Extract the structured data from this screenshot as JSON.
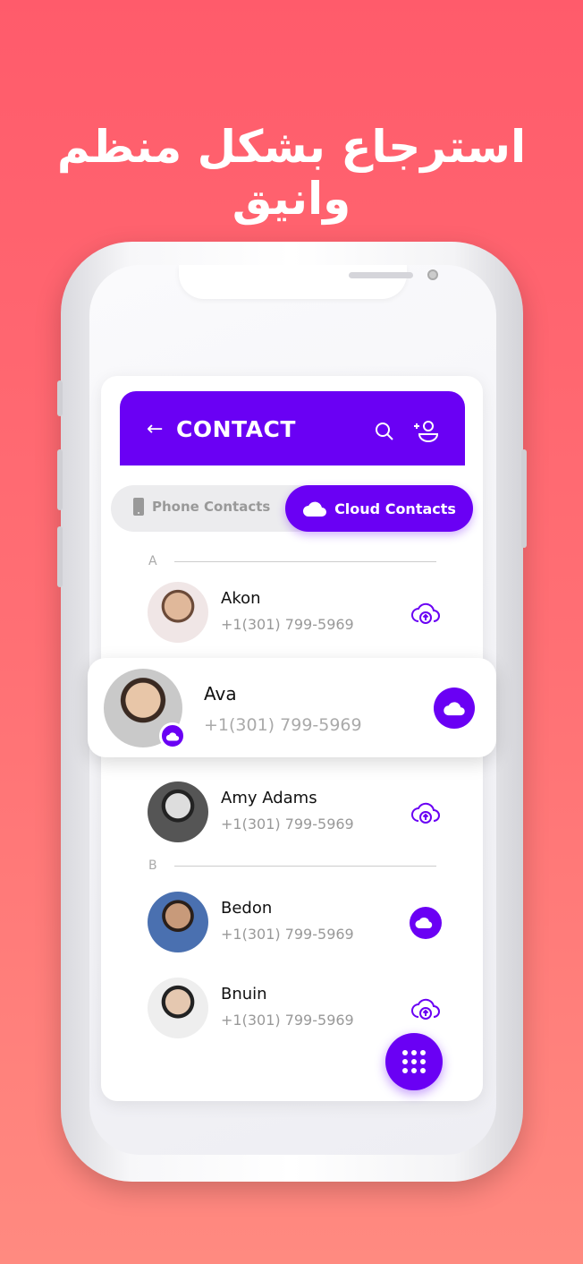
{
  "headline": "استرجاع بشكل منظم وانيق",
  "header": {
    "title": "CONTACT",
    "back_icon": "arrow-left-icon",
    "search_icon": "search-icon",
    "add_icon": "add-user-icon"
  },
  "tabs": {
    "phone": "Phone Contacts",
    "cloud": "Cloud Contacts",
    "active": "cloud"
  },
  "sections": [
    "A",
    "B"
  ],
  "contacts": [
    {
      "name": "Akon",
      "phone": "+1(301) 799-5969",
      "status": "upload"
    },
    {
      "name": "Ava",
      "phone": "+1(301) 799-5969",
      "status": "synced"
    },
    {
      "name": "Amy Adams",
      "phone": "+1(301) 799-5969",
      "status": "upload"
    },
    {
      "name": "Bedon",
      "phone": "+1(301) 799-5969",
      "status": "synced"
    },
    {
      "name": "Bnuin",
      "phone": "+1(301) 799-5969",
      "status": "upload"
    }
  ],
  "colors": {
    "accent": "#6a00f4",
    "background": "#ff6a72"
  }
}
